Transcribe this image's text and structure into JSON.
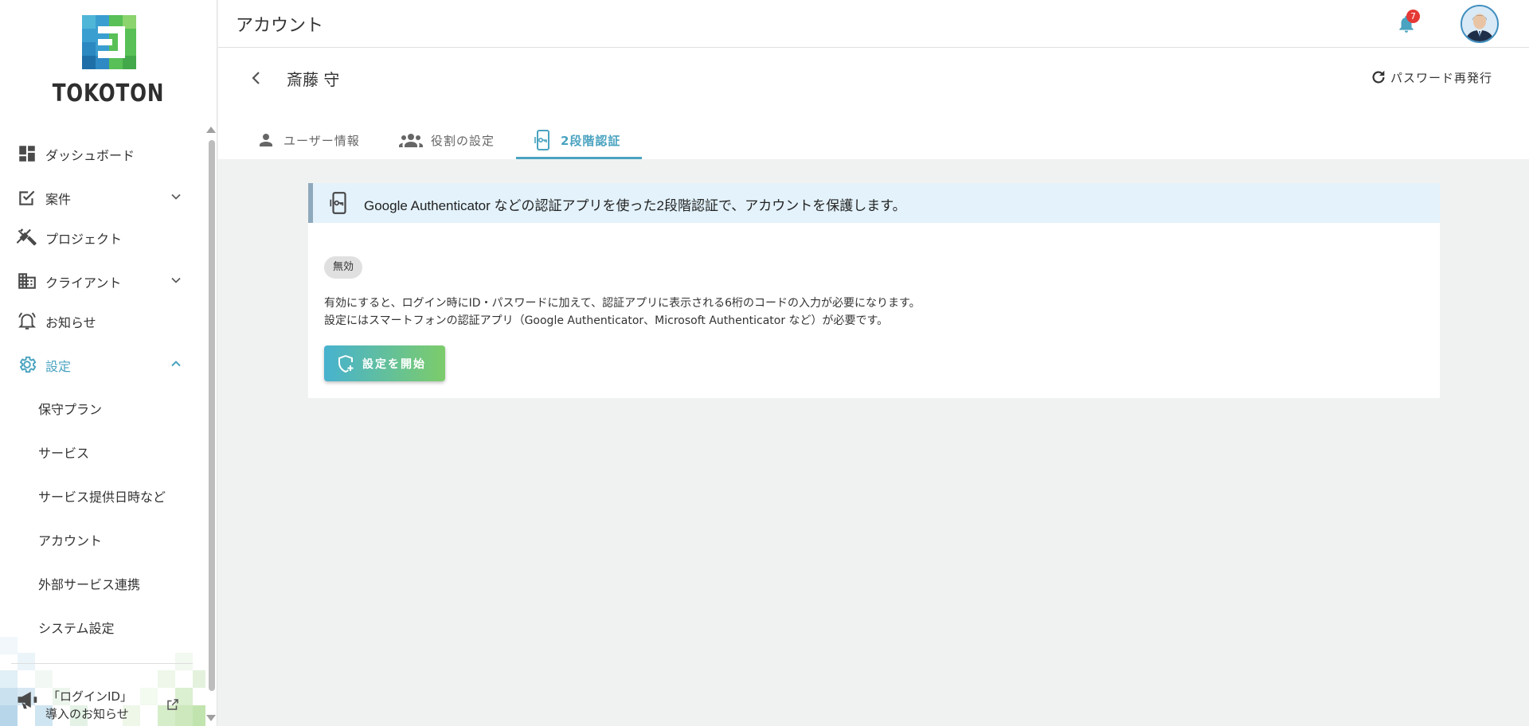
{
  "app": {
    "brand": "TOKOTON"
  },
  "header": {
    "title": "アカウント",
    "notification_count": "7"
  },
  "sidebar": {
    "items": [
      {
        "label": "ダッシュボード",
        "icon": "dashboard-icon"
      },
      {
        "label": "案件",
        "icon": "task-check-icon",
        "expandable": true
      },
      {
        "label": "プロジェクト",
        "icon": "tools-icon"
      },
      {
        "label": "クライアント",
        "icon": "building-icon",
        "expandable": true
      },
      {
        "label": "お知らせ",
        "icon": "bell-ring-icon"
      },
      {
        "label": "設定",
        "icon": "gear-icon",
        "expanded": true,
        "active": true
      }
    ],
    "sub_items": [
      {
        "label": "保守プラン"
      },
      {
        "label": "サービス"
      },
      {
        "label": "サービス提供日時など"
      },
      {
        "label": "アカウント"
      },
      {
        "label": "外部サービス連携"
      },
      {
        "label": "システム設定"
      }
    ],
    "notice": {
      "line1": "「ログインID」",
      "line2": "導入のお知らせ"
    }
  },
  "account": {
    "user_name": "斎藤 守",
    "password_reset_label": "パスワード再発行",
    "tabs": [
      {
        "label": "ユーザー情報",
        "icon": "person-icon"
      },
      {
        "label": "役割の設定",
        "icon": "group-icon"
      },
      {
        "label": "2段階認証",
        "icon": "phone-key-icon",
        "active": true
      }
    ]
  },
  "two_factor": {
    "info": "Google Authenticator などの認証アプリを使った2段階認証で、アカウントを保護します。",
    "status": "無効",
    "description_line1": "有効にすると、ログイン時にID・パスワードに加えて、認証アプリに表示される6桁のコードの入力が必要になります。",
    "description_line2": "設定にはスマートフォンの認証アプリ（Google Authenticator、Microsoft Authenticator など）が必要です。",
    "start_button": "設定を開始"
  },
  "colors": {
    "accent": "#4aa3c0",
    "info_bg": "#e3f2fb",
    "button_gradient_start": "#47b2cf",
    "button_gradient_end": "#7ccc6a",
    "badge": "#e53935"
  }
}
